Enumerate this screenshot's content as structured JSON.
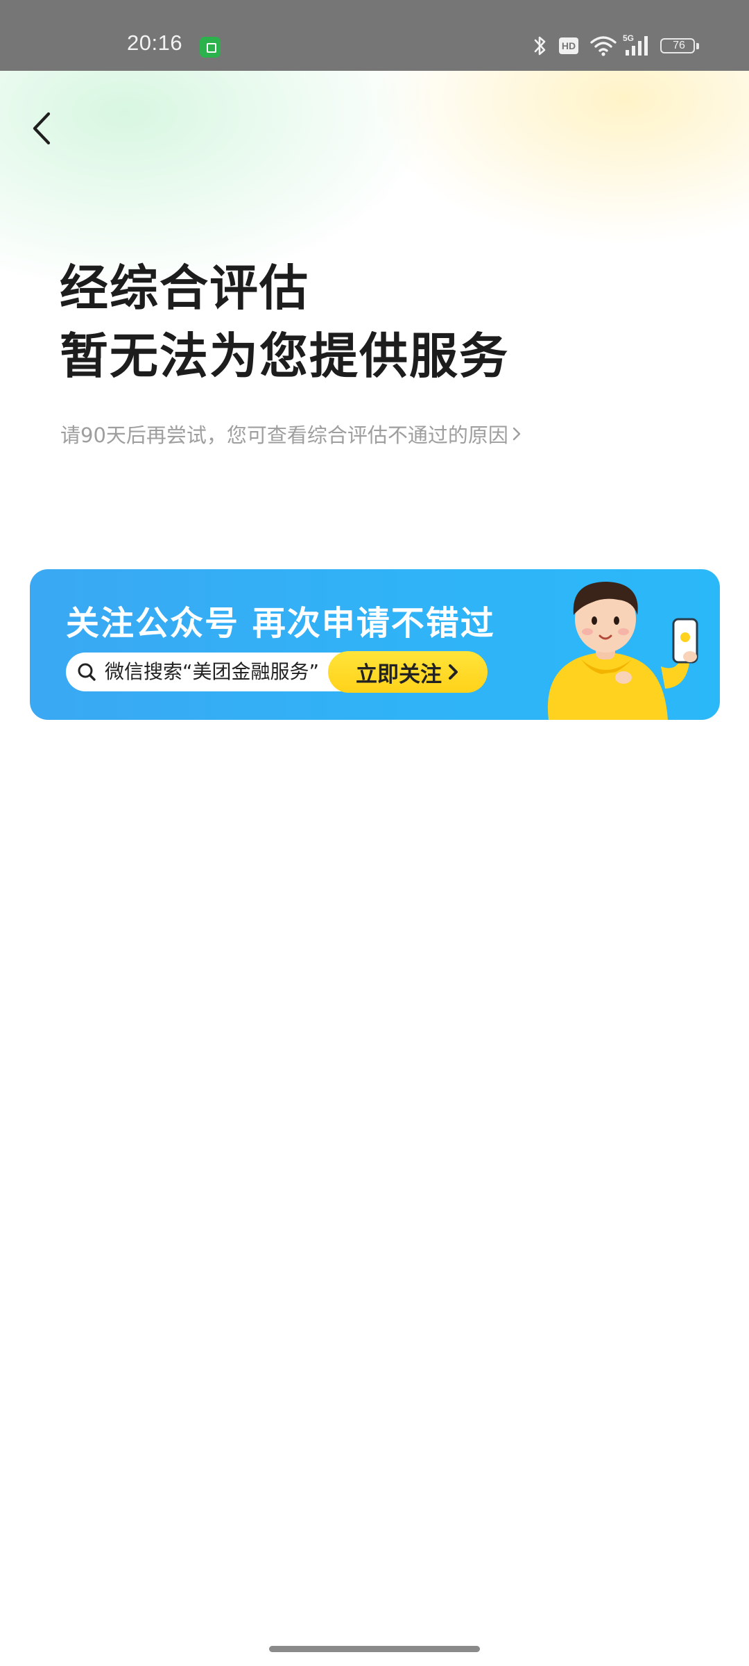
{
  "status_bar": {
    "time": "20:16",
    "battery": "76",
    "network": "5G",
    "hd_label": "HD"
  },
  "header": {
    "back_icon": "chevron-left-icon"
  },
  "result": {
    "title_line1": "经综合评估",
    "title_line2": "暂无法为您提供服务",
    "subtitle": "请90天后再尝试，您可查看综合评估不通过的原因"
  },
  "banner": {
    "title": "关注公众号 再次申请不错过",
    "search_text": "微信搜索“美团金融服务”",
    "button_label": "立即关注",
    "colors": {
      "background": "#30b3f7",
      "button": "#ffd21a"
    }
  }
}
